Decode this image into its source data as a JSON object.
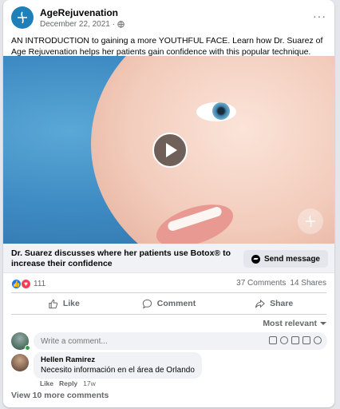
{
  "post": {
    "page_name": "AgeRejuvenation",
    "date": "December 22, 2021 ·",
    "more_label": "···",
    "text": "AN INTRODUCTION to gaining a more YOUTHFUL FACE. Learn how Dr. Suarez of Age Rejuvenation helps her patients gain confidence with this popular technique."
  },
  "link": {
    "title": "Dr. Suarez discusses where her patients use Botox® to increase their confidence",
    "cta": "Send message"
  },
  "engagement": {
    "reaction_count": "111",
    "comments": "37 Comments",
    "shares": "14 Shares"
  },
  "actions": {
    "like": "Like",
    "comment": "Comment",
    "share": "Share"
  },
  "sort_label": "Most relevant",
  "comment_box": {
    "placeholder": "Write a comment..."
  },
  "comment": {
    "author": "Hellen Ramirez",
    "text": "Necesito información en el área de Orlando",
    "like": "Like",
    "reply": "Reply",
    "time": "17w"
  },
  "view_more": "View 10 more comments",
  "colors": {
    "accent": "#1877f2",
    "love": "#f33e58",
    "brand": "#1f7fb8"
  }
}
